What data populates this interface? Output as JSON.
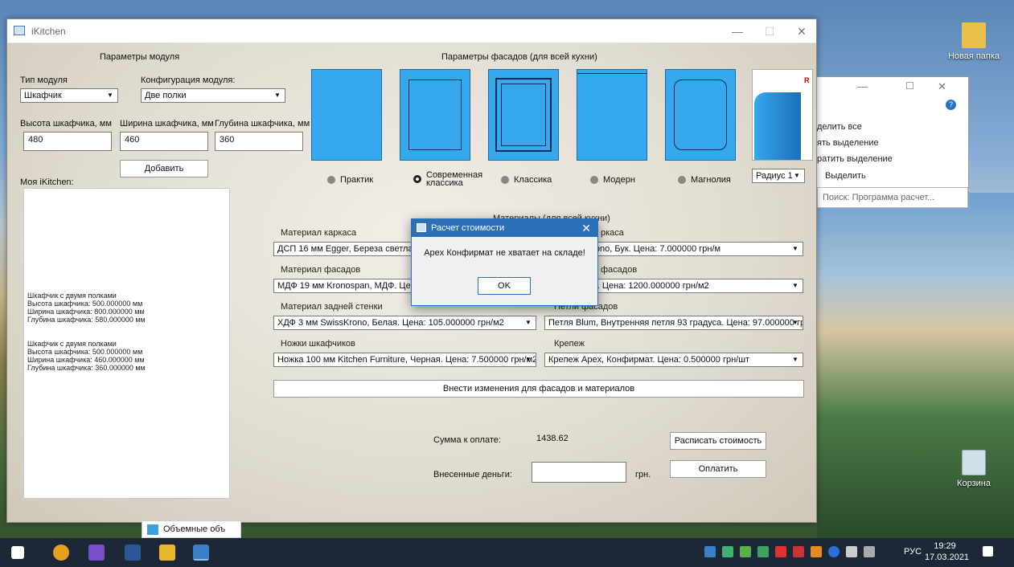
{
  "desktop": {
    "folder_label": "Новая папка",
    "recycle_label": "Корзина"
  },
  "explorer": {
    "items": [
      "делить все",
      "ять выделение",
      "ратить выделение",
      "Выделить"
    ],
    "search_placeholder": "Поиск: Программа расчет..."
  },
  "window": {
    "title": "iKitchen",
    "minimize": "—",
    "maximize": "☐",
    "close": "✕"
  },
  "module": {
    "header": "Параметры модуля",
    "type_label": "Тип модуля",
    "type_value": "Шкафчик",
    "config_label": "Конфигурация модуля:",
    "config_value": "Две полки",
    "height_label": "Высота шкафчика, мм",
    "height_value": "480",
    "width_label": "Ширина шкафчика, мм",
    "width_value": "460",
    "depth_label": "Глубина шкафчика, мм",
    "depth_value": "360",
    "add_button": "Добавить",
    "my_label": "Моя iKitchen:"
  },
  "list_items": [
    [
      "Шкафчик с двумя полками",
      "Высота шкафчика: 500.000000 мм",
      "Ширина шкафчика: 800.000000 мм",
      "Глубина шкафчика: 580.000000 мм"
    ],
    [
      "Шкафчик с двумя полками",
      "Высота шкафчика: 500.000000 мм",
      "Ширина шкафчика: 460.000000 мм",
      "Глубина шкафчика: 360.000000 мм"
    ]
  ],
  "facades": {
    "header": "Параметры фасадов (для всей кухни)",
    "options": [
      "Практик",
      "Современная классика",
      "Классика",
      "Модерн",
      "Магнолия"
    ],
    "selected": "Современная классика",
    "radius_value": "Радиус 1",
    "radius_mark": "R"
  },
  "materials": {
    "header": "Материалы (для всей кухни)",
    "frame_label": "Материал каркаса",
    "frame_value": "ДСП 16 мм Egger, Береза светлая. Ц",
    "edge_label": "ркаса",
    "edge_value": "мм SwissKrono, Бук. Цена: 7.000000 грн/м",
    "facade_label": "Материал фасадов",
    "facade_value": "МДФ 19 мм Kronospan, МДФ. Цена: 1",
    "paint_label": "фасадов",
    "paint_value": "о, RAL 1013. Цена: 1200.000000 грн/м2",
    "back_label": "Материал задней стенки",
    "back_value": "ХДФ 3 мм SwissKrono, Белая. Цена: 105.000000 грн/м2",
    "hinges_label": "Петли фасадов",
    "hinges_value": "Петля Blum, Внутренняя петля 93 градуса. Цена: 97.000000 грн",
    "legs_label": "Ножки шкафчиков",
    "legs_value": "Ножка 100 мм Kitchen Furniture, Черная. Цена: 7.500000 грн/м2",
    "fastener_label": "Крепеж",
    "fastener_value": "Крепеж Apex, Конфирмат. Цена: 0.500000 грн/шт",
    "apply_button": "Внести изменения для фасадов и материалов"
  },
  "payment": {
    "sum_label": "Сумма к оплате:",
    "sum_value": "1438.62",
    "paid_label": "Внесенные деньги:",
    "paid_value": "",
    "currency": "грн.",
    "detail_button": "Расписать стоимость",
    "pay_button": "Оплатить"
  },
  "dialog": {
    "title": "Расчет стоимости",
    "message": "Apex Конфирмат не хватает на складе!",
    "ok": "OK",
    "close": "✕"
  },
  "tooltip": {
    "text": "Объемные объ"
  },
  "taskbar": {
    "lang": "РУС",
    "time": "19:29",
    "date": "17.03.2021"
  },
  "colors": {
    "facade": "#35a8ee",
    "titlebar_dialog": "#2b6fb8",
    "taskbar": "#1c2836"
  }
}
